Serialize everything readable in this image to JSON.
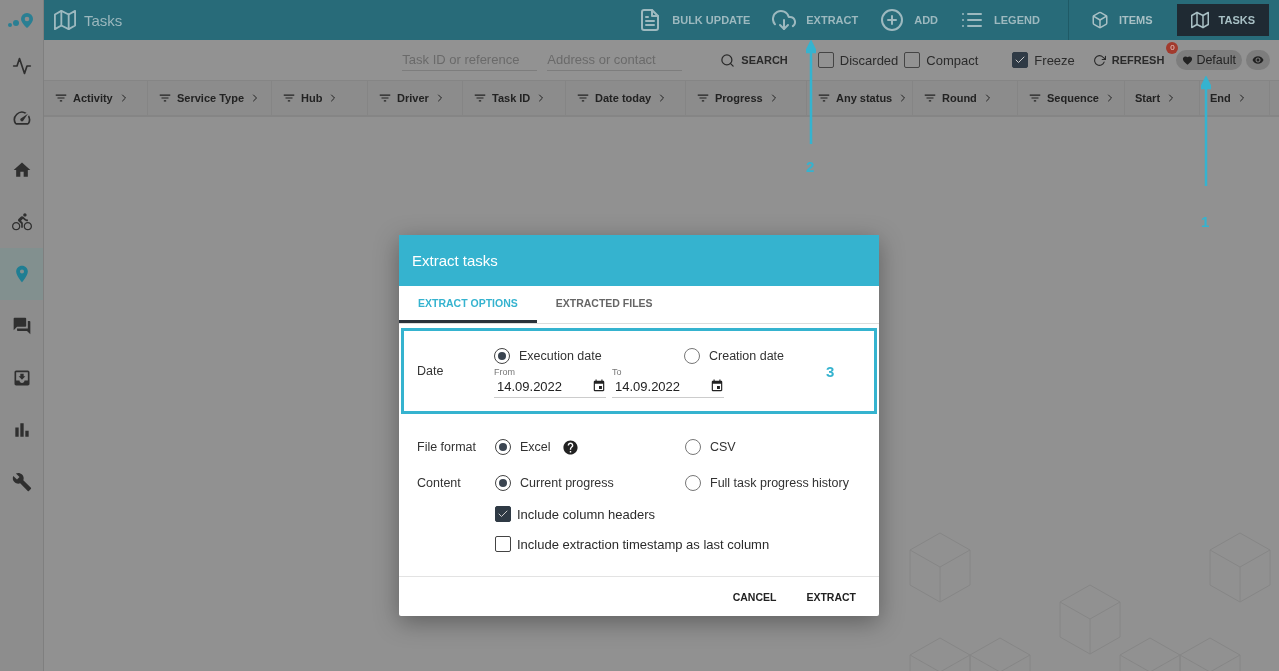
{
  "app_bar": {
    "title": "Tasks",
    "actions": [
      {
        "label": "BULK UPDATE",
        "kind": "document"
      },
      {
        "label": "EXTRACT",
        "kind": "cloud"
      },
      {
        "label": "ADD",
        "kind": "plus"
      },
      {
        "label": "LEGEND",
        "kind": "list"
      }
    ],
    "views": [
      {
        "label": "ITEMS",
        "kind": "cube",
        "selected": false
      },
      {
        "label": "TASKS",
        "kind": "map",
        "selected": true
      }
    ]
  },
  "sidebar": {
    "items": [
      {
        "kind": "pulse",
        "selected": false
      },
      {
        "kind": "gauge",
        "selected": false
      },
      {
        "kind": "home",
        "selected": false
      },
      {
        "kind": "bike",
        "selected": false
      },
      {
        "kind": "pin",
        "selected": true
      },
      {
        "kind": "chat",
        "selected": false
      },
      {
        "kind": "inbox",
        "selected": false
      },
      {
        "kind": "chart",
        "selected": false
      },
      {
        "kind": "wrench",
        "selected": false
      }
    ]
  },
  "filters": {
    "task_id": {
      "placeholder": "Task ID or reference"
    },
    "address": {
      "placeholder": "Address or contact"
    },
    "search": "SEARCH",
    "toggles": [
      {
        "label": "Discarded",
        "checked": false
      },
      {
        "label": "Compact",
        "checked": false
      },
      {
        "label": "Freeze",
        "checked": true
      }
    ],
    "refresh": "REFRESH",
    "refresh_badge": "0",
    "view": "Default"
  },
  "columns": [
    {
      "label": "Activity",
      "filterable": true
    },
    {
      "label": "Service Type",
      "filterable": true
    },
    {
      "label": "Hub",
      "filterable": true
    },
    {
      "label": "Driver",
      "filterable": true
    },
    {
      "label": "Task ID",
      "filterable": true
    },
    {
      "label": "Date today",
      "filterable": true
    },
    {
      "label": "Progress",
      "filterable": true
    },
    {
      "label": "Any status",
      "filterable": true
    },
    {
      "label": "Round",
      "filterable": true
    },
    {
      "label": "Sequence",
      "filterable": true
    },
    {
      "label": "Start",
      "filterable": false
    },
    {
      "label": "End",
      "filterable": false
    }
  ],
  "annotations": [
    {
      "label": "1"
    },
    {
      "label": "2"
    },
    {
      "label": "3"
    }
  ],
  "dialog": {
    "title": "Extract tasks",
    "tabs": [
      {
        "label": "EXTRACT OPTIONS",
        "selected": true
      },
      {
        "label": "EXTRACTED FILES",
        "selected": false
      }
    ],
    "date": {
      "label": "Date",
      "options": [
        {
          "label": "Execution date",
          "selected": true
        },
        {
          "label": "Creation date",
          "selected": false
        }
      ],
      "from": {
        "label": "From",
        "value": "14.09.2022"
      },
      "to": {
        "label": "To",
        "value": "14.09.2022"
      }
    },
    "file_format": {
      "label": "File format",
      "options": [
        {
          "label": "Excel",
          "selected": true,
          "help": true
        },
        {
          "label": "CSV",
          "selected": false,
          "help": false
        }
      ]
    },
    "content": {
      "label": "Content",
      "options": [
        {
          "label": "Current progress",
          "selected": true
        },
        {
          "label": "Full task progress history",
          "selected": false
        }
      ]
    },
    "checkboxes": [
      {
        "label": "Include column headers",
        "checked": true
      },
      {
        "label": "Include extraction timestamp as last column",
        "checked": false
      }
    ],
    "buttons": [
      "CANCEL",
      "EXTRACT"
    ]
  }
}
